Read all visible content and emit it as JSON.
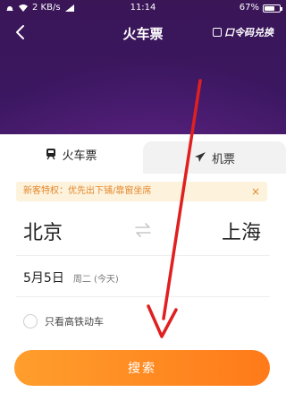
{
  "status_bar": {
    "speed": "2 KB/s",
    "time": "11:14",
    "battery_text": "67%",
    "battery_level": 0.67
  },
  "titlebar": {
    "title": "火车票",
    "redeem_label": "口令码兑换"
  },
  "tabs": [
    {
      "label": "火车票",
      "icon": "train-icon",
      "selected": true
    },
    {
      "label": "机票",
      "icon": "plane-icon",
      "selected": false
    }
  ],
  "promo": {
    "text": "新客特权：优先出下铺/靠窗坐席",
    "close": "×"
  },
  "route": {
    "from": "北京",
    "to": "上海"
  },
  "date": {
    "main": "5月5日",
    "sub": "周二 (今天)"
  },
  "filter": {
    "hsr_label": "只看高铁动车",
    "checked": false
  },
  "search_label": "搜索",
  "colors": {
    "header": "#3b1761",
    "accent": "#ff8c21",
    "promo_text": "#e2862a",
    "annotation": "#e02020"
  }
}
